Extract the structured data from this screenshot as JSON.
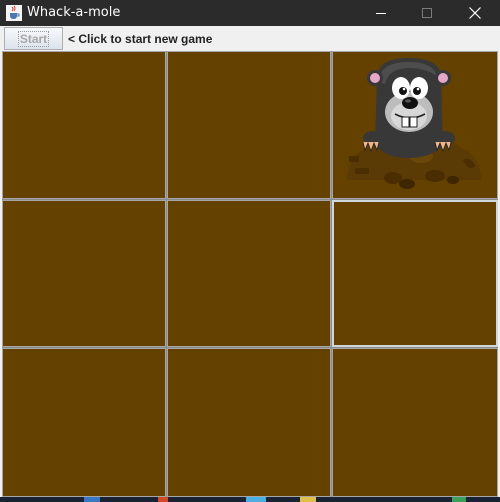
{
  "window": {
    "title": "Whack-a-mole",
    "app_icon": "java-cup-icon",
    "controls": [
      "minimize-icon",
      "maximize-icon",
      "close-icon"
    ]
  },
  "toolbar": {
    "start_label": "Start",
    "hint_text": "< Click to start new game"
  },
  "board": {
    "rows": 3,
    "cols": 3,
    "cells": [
      {
        "row": 1,
        "col": 1,
        "has_mole": false
      },
      {
        "row": 1,
        "col": 2,
        "has_mole": false
      },
      {
        "row": 1,
        "col": 3,
        "has_mole": true
      },
      {
        "row": 2,
        "col": 1,
        "has_mole": false
      },
      {
        "row": 2,
        "col": 2,
        "has_mole": false
      },
      {
        "row": 2,
        "col": 3,
        "has_mole": false,
        "focused": true
      },
      {
        "row": 3,
        "col": 1,
        "has_mole": false
      },
      {
        "row": 3,
        "col": 2,
        "has_mole": false
      },
      {
        "row": 3,
        "col": 3,
        "has_mole": false
      }
    ]
  },
  "colors": {
    "hole": "#654100",
    "grid_line": "#a6a6a6",
    "titlebar": "#2b2b2b"
  }
}
